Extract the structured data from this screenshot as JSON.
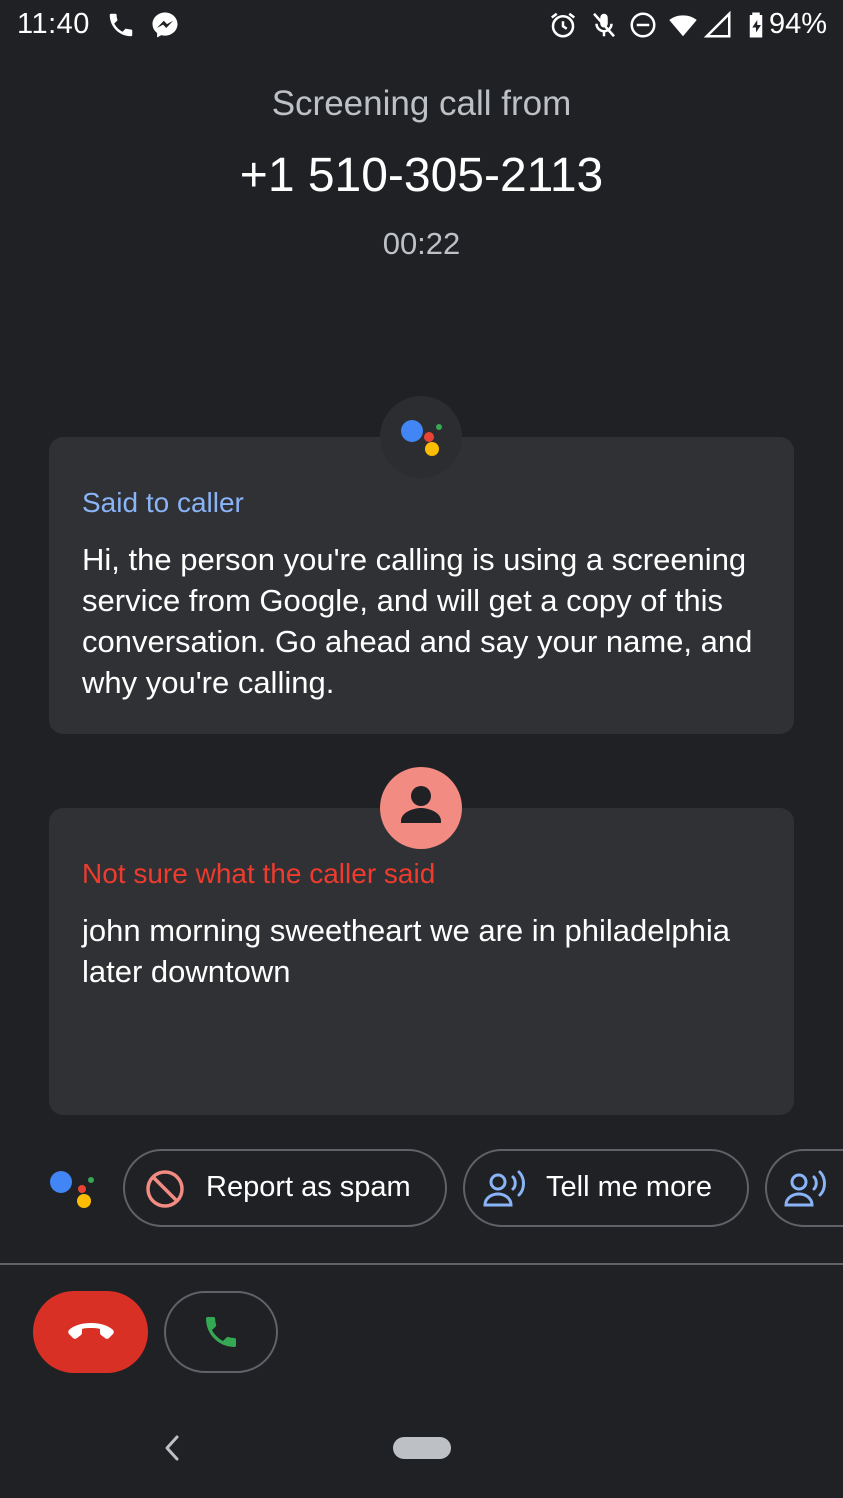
{
  "status_bar": {
    "time": "11:40",
    "battery_percent": "94%",
    "icons": [
      "phone-icon",
      "messenger-icon",
      "alarm-icon",
      "mic-off-icon",
      "do-not-disturb-icon",
      "wifi-icon",
      "signal-icon",
      "battery-charging-icon"
    ]
  },
  "header": {
    "label": "Screening call from",
    "number": "+1 510-305-2113",
    "timer": "00:22"
  },
  "assistant_card": {
    "label": "Said to caller",
    "text": "Hi, the person you're calling is using a screening service from Google, and will get a copy of this conversation. Go ahead and say your name, and why you're calling."
  },
  "caller_card": {
    "label": "Not sure what the caller said",
    "text": "john morning sweetheart we are in philadelphia later downtown"
  },
  "chips": [
    {
      "label": "Report as spam",
      "icon": "block-icon"
    },
    {
      "label": "Tell me more",
      "icon": "speaking-person-icon"
    },
    {
      "label": "",
      "icon": "speaking-person-icon"
    }
  ],
  "colors": {
    "background": "#202124",
    "card": "#303134",
    "assistant_label": "#8ab4f8",
    "caller_label": "#ee3b2e",
    "decline": "#d93025",
    "answer_icon": "#34a853"
  }
}
